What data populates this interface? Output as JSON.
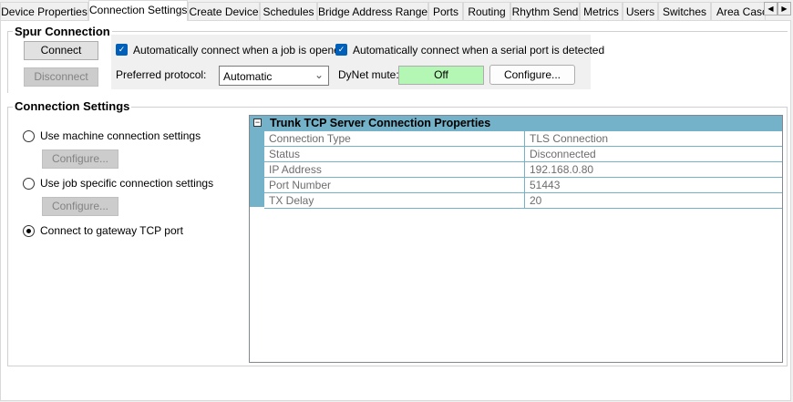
{
  "tabs": [
    "Device Properties",
    "Connection Settings",
    "Create Device",
    "Schedules",
    "Bridge Address Ranges",
    "Ports",
    "Routing",
    "Rhythm Send",
    "Metrics",
    "Users",
    "Switches",
    "Area Cascade"
  ],
  "selected_tab": "Connection Settings",
  "spur": {
    "title": "Spur Connection",
    "connect": "Connect",
    "disconnect": "Disconnect",
    "auto_job": "Automatically connect when a job is opened",
    "auto_job_checked": true,
    "auto_serial": "Automatically connect when a serial port is detected",
    "auto_serial_checked": true,
    "protocol_label": "Preferred protocol:",
    "protocol_value": "Automatic",
    "mute_label": "DyNet mute:",
    "mute_value": "Off",
    "configure": "Configure..."
  },
  "conn": {
    "title": "Connection Settings",
    "options": [
      {
        "label": "Use machine connection settings",
        "selected": false,
        "configure": "Configure..."
      },
      {
        "label": "Use job specific connection settings",
        "selected": false,
        "configure": "Configure..."
      },
      {
        "label": "Connect to gateway TCP port",
        "selected": true
      }
    ],
    "grid": {
      "header": "Trunk TCP Server Connection Properties",
      "rows": [
        [
          "Connection Type",
          "TLS Connection"
        ],
        [
          "Status",
          "Disconnected"
        ],
        [
          "IP Address",
          "192.168.0.80"
        ],
        [
          "Port Number",
          "51443"
        ],
        [
          "TX Delay",
          "20"
        ]
      ]
    }
  },
  "colors": {
    "grid_header": "#73b2c8",
    "mute_off": "#b4f7b4",
    "checkbox": "#005fb8"
  }
}
